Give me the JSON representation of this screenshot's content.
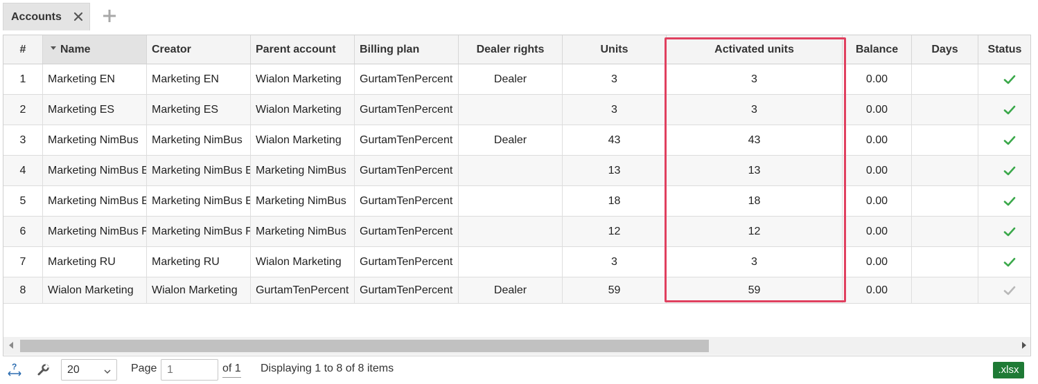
{
  "tabs": {
    "active_label": "Accounts",
    "close_icon": "close-icon",
    "add_icon": "plus-icon"
  },
  "grid": {
    "columns": [
      {
        "label": "#"
      },
      {
        "label": "Name",
        "sorted": "desc"
      },
      {
        "label": "Creator"
      },
      {
        "label": "Parent account"
      },
      {
        "label": "Billing plan"
      },
      {
        "label": "Dealer rights"
      },
      {
        "label": "Units"
      },
      {
        "label": "Activated units"
      },
      {
        "label": "Balance"
      },
      {
        "label": "Days"
      },
      {
        "label": "Status"
      }
    ],
    "rows": [
      {
        "num": "1",
        "name": "Marketing EN",
        "creator": "Marketing EN",
        "parent": "Wialon Marketing",
        "billing": "GurtamTenPercent",
        "dealer": "Dealer",
        "units": "3",
        "activated": "3",
        "balance": "0.00",
        "days": "",
        "status": "active"
      },
      {
        "num": "2",
        "name": "Marketing ES",
        "creator": "Marketing ES",
        "parent": "Wialon Marketing",
        "billing": "GurtamTenPercent",
        "dealer": "",
        "units": "3",
        "activated": "3",
        "balance": "0.00",
        "days": "",
        "status": "active"
      },
      {
        "num": "3",
        "name": "Marketing NimBus",
        "creator": "Marketing NimBus",
        "parent": "Wialon Marketing",
        "billing": "GurtamTenPercent",
        "dealer": "Dealer",
        "units": "43",
        "activated": "43",
        "balance": "0.00",
        "days": "",
        "status": "active"
      },
      {
        "num": "4",
        "name": "Marketing NimBus E",
        "creator": "Marketing NimBus E",
        "parent": "Marketing NimBus",
        "billing": "GurtamTenPercent",
        "dealer": "",
        "units": "13",
        "activated": "13",
        "balance": "0.00",
        "days": "",
        "status": "active"
      },
      {
        "num": "5",
        "name": "Marketing NimBus E",
        "creator": "Marketing NimBus E",
        "parent": "Marketing NimBus",
        "billing": "GurtamTenPercent",
        "dealer": "",
        "units": "18",
        "activated": "18",
        "balance": "0.00",
        "days": "",
        "status": "active"
      },
      {
        "num": "6",
        "name": "Marketing NimBus F",
        "creator": "Marketing NimBus F",
        "parent": "Marketing NimBus",
        "billing": "GurtamTenPercent",
        "dealer": "",
        "units": "12",
        "activated": "12",
        "balance": "0.00",
        "days": "",
        "status": "active"
      },
      {
        "num": "7",
        "name": "Marketing RU",
        "creator": "Marketing RU",
        "parent": "Wialon Marketing",
        "billing": "GurtamTenPercent",
        "dealer": "",
        "units": "3",
        "activated": "3",
        "balance": "0.00",
        "days": "",
        "status": "active"
      },
      {
        "num": "8",
        "name": "Wialon Marketing",
        "creator": "Wialon Marketing",
        "parent": "GurtamTenPercent",
        "billing": "GurtamTenPercent",
        "dealer": "Dealer",
        "units": "59",
        "activated": "59",
        "balance": "0.00",
        "days": "",
        "status": "inactive"
      }
    ]
  },
  "colors": {
    "highlight": "#e0405f",
    "status_active": "#3aa84a",
    "status_inactive": "#b8b8b8",
    "xlsx_button": "#1e7a35"
  },
  "footer": {
    "help_icon": "help-resize-icon",
    "settings_icon": "wrench-icon",
    "page_size": "20",
    "page_label": "Page",
    "page_placeholder": "1",
    "of_label": "of 1",
    "display_text": "Displaying 1 to 8 of 8 items",
    "export_label": ".xlsx"
  }
}
